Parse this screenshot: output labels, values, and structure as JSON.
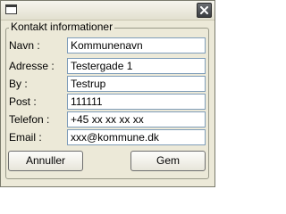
{
  "window": {
    "title": "",
    "close_icon": "close-icon",
    "system_icon": "window-icon"
  },
  "group": {
    "legend": "Kontakt informationer"
  },
  "fields": [
    {
      "label": "Navn :",
      "value": "Kommunenavn"
    },
    {
      "label": "Adresse :",
      "value": "Testergade 1"
    },
    {
      "label": "By :",
      "value": "Testrup"
    },
    {
      "label": "Post :",
      "value": "111111"
    },
    {
      "label": "Telefon :",
      "value": "+45 xx xx xx xx"
    },
    {
      "label": "Email :",
      "value": "xxx@kommune.dk"
    }
  ],
  "buttons": {
    "cancel": "Annuller",
    "save": "Gem"
  },
  "colors": {
    "window_bg": "#ece9d8",
    "input_border": "#7f9db9",
    "close_button": "#3a3d41"
  }
}
